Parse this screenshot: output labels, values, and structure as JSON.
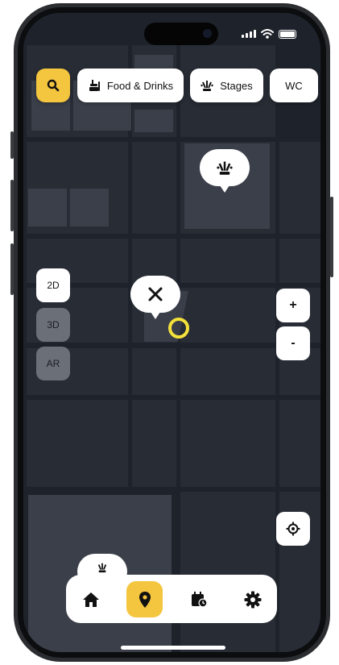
{
  "status_bar": {
    "signal": "signal-bars-icon",
    "wifi": "wifi-icon",
    "battery": "battery-icon"
  },
  "filters": {
    "search_icon": "search-icon",
    "items": [
      {
        "label": "Food & Drinks",
        "icon": "food-drinks-icon"
      },
      {
        "label": "Stages",
        "icon": "stages-icon"
      },
      {
        "label": "WC",
        "icon": ""
      }
    ]
  },
  "view_modes": [
    {
      "label": "2D",
      "active": true
    },
    {
      "label": "3D",
      "active": false
    },
    {
      "label": "AR",
      "active": false
    }
  ],
  "zoom": {
    "in_label": "+",
    "out_label": "-"
  },
  "map_pins": [
    {
      "name": "stage-pin",
      "icon": "stages-icon"
    },
    {
      "name": "food-pin",
      "icon": "cutlery-icon"
    }
  ],
  "colors": {
    "accent": "#f4c53e",
    "map_bg": "#1f242d",
    "marker": "#f4e13a"
  },
  "bottom_nav": {
    "items": [
      {
        "name": "home",
        "icon": "home-icon",
        "active": false
      },
      {
        "name": "map",
        "icon": "map-pin-icon",
        "active": true
      },
      {
        "name": "schedule",
        "icon": "calendar-clock-icon",
        "active": false
      },
      {
        "name": "settings",
        "icon": "gear-icon",
        "active": false
      }
    ]
  }
}
